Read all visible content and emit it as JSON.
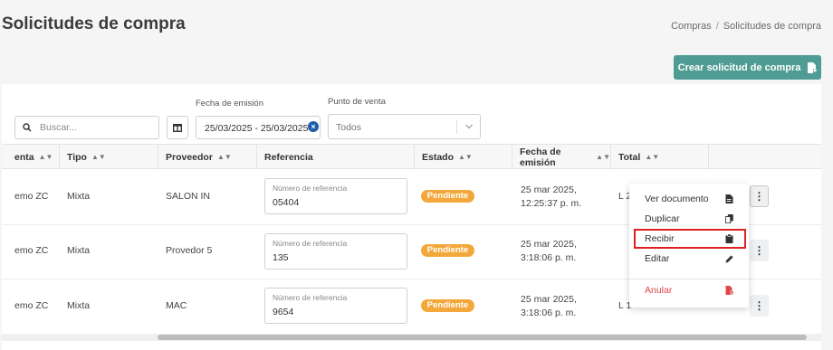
{
  "page": {
    "title": "Solicitudes de compra"
  },
  "breadcrumb": {
    "parent": "Compras",
    "separator": "/",
    "current": "Solicitudes de compra"
  },
  "actions": {
    "create_label": "Crear solicitud de compra"
  },
  "filters": {
    "search_placeholder": "Buscar...",
    "date_label": "Fecha de emisión",
    "date_value": "25/03/2025  - 25/03/2025",
    "pos_label": "Punto de venta",
    "pos_value": "Todos"
  },
  "table": {
    "columns": [
      "enta",
      "Tipo",
      "Proveedor",
      "Referencia",
      "Estado",
      "Fecha de emisión",
      "Total"
    ],
    "ref_field_label": "Número de referencia",
    "rows": [
      {
        "sucursal": "emo ZC",
        "tipo": "Mixta",
        "proveedor": "SALON IN",
        "referencia": "05404",
        "estado": "Pendiente",
        "fecha_line1": "25 mar 2025,",
        "fecha_line2": "12:25:37 p. m.",
        "total": "L 2"
      },
      {
        "sucursal": "emo ZC",
        "tipo": "Mixta",
        "proveedor": "Provedor 5",
        "referencia": "135",
        "estado": "Pendiente",
        "fecha_line1": "25 mar 2025,",
        "fecha_line2": "3:18:06 p. m.",
        "total": ""
      },
      {
        "sucursal": "emo ZC",
        "tipo": "Mixta",
        "proveedor": "MAC",
        "referencia": "9654",
        "estado": "Pendiente",
        "fecha_line1": "25 mar 2025,",
        "fecha_line2": "3:18:06 p. m.",
        "total": "L 1"
      }
    ]
  },
  "row_menu": {
    "items": [
      "Ver documento",
      "Duplicar",
      "Recibir",
      "Editar",
      "Anular"
    ],
    "highlighted": "Recibir"
  },
  "colors": {
    "accent": "#4e9c93",
    "pending": "#f3a83b",
    "danger": "#e04848",
    "highlight": "#e02020"
  }
}
